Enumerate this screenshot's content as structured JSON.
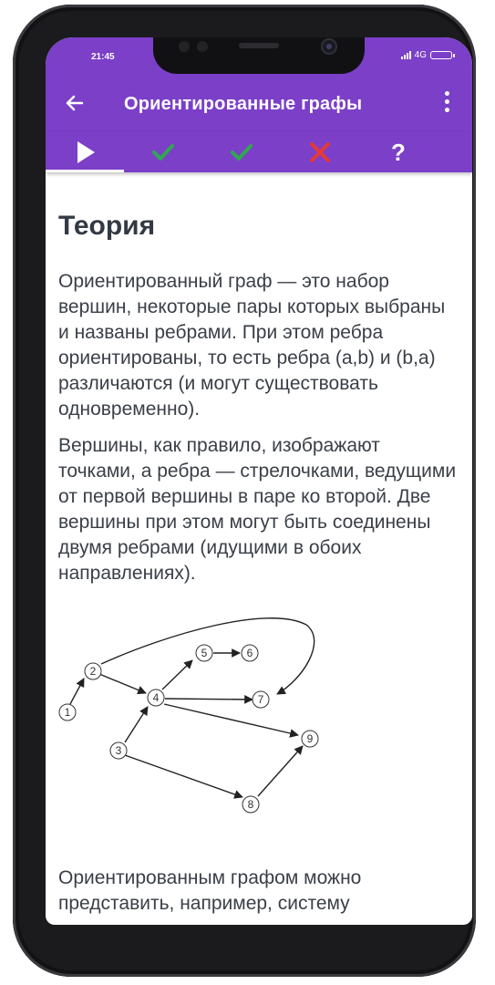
{
  "status_bar": {
    "time": "21:45",
    "network": "4G",
    "icons": [
      "signal-icon",
      "battery-icon"
    ]
  },
  "app_bar": {
    "title": "Ориентированные графы",
    "icons": [
      "back-arrow-icon",
      "more-vert-icon"
    ]
  },
  "tabs": [
    {
      "name": "play",
      "icon": "play-icon",
      "selected": true
    },
    {
      "name": "correct-1",
      "icon": "checkmark-icon"
    },
    {
      "name": "correct-2",
      "icon": "checkmark-icon"
    },
    {
      "name": "wrong",
      "icon": "cross-icon"
    },
    {
      "name": "help",
      "label": "?"
    }
  ],
  "colors": {
    "primary": "#7b3fc8",
    "check": "#2fa84f",
    "cross": "#e53935",
    "text": "#3a3f47"
  },
  "content": {
    "heading": "Теория",
    "paragraph_1": "Ориентированный граф — это набор вершин, некоторые пары которых выбраны и названы ребрами. При этом ребра ориентированы, то есть ребра (a,b) и (b,a) различаются (и могут существовать одновременно).",
    "paragraph_2": "Вершины, как правило, изображают точками, а ребра — стрелочками, ведущими от первой вершины в паре ко второй. Две вершины при этом могут быть соединены двумя ребрами (идущими в обоих направлениях).",
    "paragraph_3": "Ориентированным графом можно представить, например, систему"
  },
  "graph": {
    "nodes": [
      "1",
      "2",
      "3",
      "4",
      "5",
      "6",
      "7",
      "8",
      "9"
    ],
    "edges": [
      [
        "1",
        "2"
      ],
      [
        "2",
        "4"
      ],
      [
        "2",
        "7"
      ],
      [
        "3",
        "4"
      ],
      [
        "3",
        "8"
      ],
      [
        "4",
        "5"
      ],
      [
        "4",
        "7"
      ],
      [
        "4",
        "9"
      ],
      [
        "5",
        "6"
      ],
      [
        "8",
        "9"
      ]
    ]
  }
}
